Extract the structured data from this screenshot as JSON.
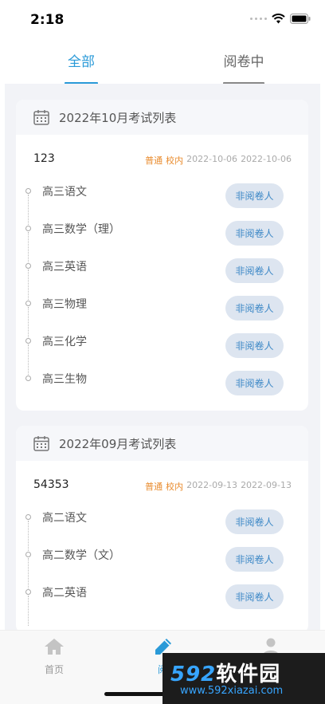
{
  "status_bar": {
    "time": "2:18"
  },
  "tabs": [
    {
      "label": "全部",
      "active": true
    },
    {
      "label": "阅卷中",
      "active": false
    }
  ],
  "months": [
    {
      "title": "2022年10月考试列表",
      "exam": {
        "name": "123",
        "type": "普通",
        "scope": "校内",
        "start": "2022-10-06",
        "end": "2022-10-06"
      },
      "subjects": [
        {
          "name": "高三语文",
          "status": "非阅卷人"
        },
        {
          "name": "高三数学（理）",
          "status": "非阅卷人"
        },
        {
          "name": "高三英语",
          "status": "非阅卷人"
        },
        {
          "name": "高三物理",
          "status": "非阅卷人"
        },
        {
          "name": "高三化学",
          "status": "非阅卷人"
        },
        {
          "name": "高三生物",
          "status": "非阅卷人"
        }
      ]
    },
    {
      "title": "2022年09月考试列表",
      "exam": {
        "name": "54353",
        "type": "普通",
        "scope": "校内",
        "start": "2022-09-13",
        "end": "2022-09-13"
      },
      "subjects": [
        {
          "name": "高二语文",
          "status": "非阅卷人"
        },
        {
          "name": "高二数学（文）",
          "status": "非阅卷人"
        },
        {
          "name": "高二英语",
          "status": "非阅卷人"
        }
      ]
    }
  ],
  "bottom_nav": [
    {
      "label": "首页",
      "icon": "home-icon",
      "active": false
    },
    {
      "label": "阅",
      "icon": "pencil-icon",
      "active": true
    },
    {
      "label": "",
      "icon": "user-icon",
      "active": false
    }
  ],
  "watermark": {
    "brand_num": "592",
    "brand_cn": "软件园",
    "url": "www.592xiazai.com"
  },
  "colors": {
    "accent": "#2a9ad8",
    "tag": "#e98b2d",
    "button_bg": "#dde5f0",
    "button_text": "#3b87c6"
  }
}
